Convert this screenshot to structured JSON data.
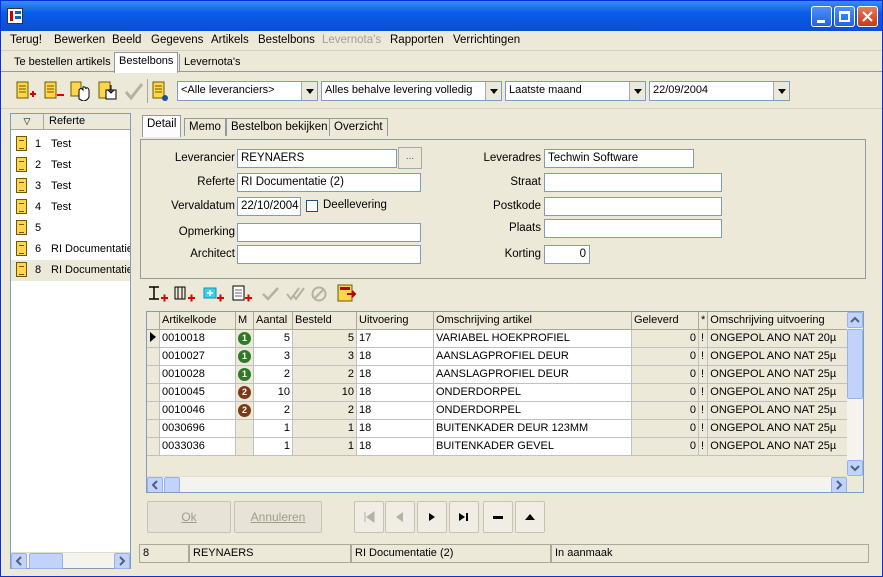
{
  "menu": {
    "items": [
      {
        "label": "Terug!",
        "disabled": false
      },
      {
        "label": "Bewerken",
        "disabled": false
      },
      {
        "label": "Beeld",
        "disabled": false
      },
      {
        "label": "Gegevens",
        "disabled": false
      },
      {
        "label": "Artikels",
        "disabled": false
      },
      {
        "label": "Bestelbons",
        "disabled": false
      },
      {
        "label": "Levernota's",
        "disabled": true
      },
      {
        "label": "Rapporten",
        "disabled": false
      },
      {
        "label": "Verrichtingen",
        "disabled": false
      }
    ]
  },
  "subtabs": [
    "Te bestellen artikels",
    "Bestelbons",
    "Levernota's"
  ],
  "filters": {
    "supplier": "<Alle leveranciers>",
    "status": "Alles behalve levering volledig",
    "period": "Laatste maand",
    "date": "22/09/2004"
  },
  "list": {
    "header_sort": "▽",
    "header_ref": "Referte",
    "rows": [
      {
        "num": "1",
        "ref": "Test"
      },
      {
        "num": "2",
        "ref": "Test"
      },
      {
        "num": "3",
        "ref": "Test"
      },
      {
        "num": "4",
        "ref": "Test"
      },
      {
        "num": "5",
        "ref": ""
      },
      {
        "num": "6",
        "ref": "RI Documentatie"
      },
      {
        "num": "8",
        "ref": "RI Documentatie"
      }
    ]
  },
  "tabs": [
    "Detail",
    "Memo",
    "Bestelbon bekijken",
    "Overzicht"
  ],
  "detail": {
    "leverancier_label": "Leverancier",
    "leverancier": "REYNAERS",
    "dots": "...",
    "referte_label": "Referte",
    "referte": "RI Documentatie (2)",
    "vervaldatum_label": "Vervaldatum",
    "vervaldatum": "22/10/2004",
    "deellevering_label": "Deellevering",
    "opmerking_label": "Opmerking",
    "opmerking": "",
    "architect_label": "Architect",
    "architect": "",
    "leveradres_label": "Leveradres",
    "leveradres": "Techwin Software",
    "straat_label": "Straat",
    "straat": "",
    "postkode_label": "Postkode",
    "postkode": "",
    "plaats_label": "Plaats",
    "plaats": "",
    "korting_label": "Korting",
    "korting": "0"
  },
  "grid": {
    "columns": [
      "Artikelkode",
      "M",
      "Aantal",
      "Besteld",
      "Uitvoering",
      "Omschrijving artikel",
      "Geleverd",
      "*",
      "Omschrijving uitvoering"
    ],
    "rows": [
      {
        "code": "0010018",
        "m": "1",
        "aantal": "5",
        "besteld": "5",
        "uitv": "17",
        "omschr": "VARIABEL HOEKPROFIEL",
        "gelev": "0",
        "star": "!",
        "omschr_uitv": "ONGEPOL ANO NAT 20µ"
      },
      {
        "code": "0010027",
        "m": "1",
        "aantal": "3",
        "besteld": "3",
        "uitv": "18",
        "omschr": "AANSLAGPROFIEL DEUR",
        "gelev": "0",
        "star": "!",
        "omschr_uitv": "ONGEPOL ANO NAT 25µ"
      },
      {
        "code": "0010028",
        "m": "1",
        "aantal": "2",
        "besteld": "2",
        "uitv": "18",
        "omschr": "AANSLAGPROFIEL DEUR",
        "gelev": "0",
        "star": "!",
        "omschr_uitv": "ONGEPOL ANO NAT 25µ"
      },
      {
        "code": "0010045",
        "m": "2",
        "aantal": "10",
        "besteld": "10",
        "uitv": "18",
        "omschr": "ONDERDORPEL",
        "gelev": "0",
        "star": "!",
        "omschr_uitv": "ONGEPOL ANO NAT 25µ"
      },
      {
        "code": "0010046",
        "m": "2",
        "aantal": "2",
        "besteld": "2",
        "uitv": "18",
        "omschr": "ONDERDORPEL",
        "gelev": "0",
        "star": "!",
        "omschr_uitv": "ONGEPOL ANO NAT 25µ"
      },
      {
        "code": "0030696",
        "m": "",
        "aantal": "1",
        "besteld": "1",
        "uitv": "18",
        "omschr": "BUITENKADER DEUR 123MM",
        "gelev": "0",
        "star": "!",
        "omschr_uitv": "ONGEPOL ANO NAT 25µ"
      },
      {
        "code": "0033036",
        "m": "",
        "aantal": "1",
        "besteld": "1",
        "uitv": "18",
        "omschr": "BUITENKADER GEVEL",
        "gelev": "0",
        "star": "!",
        "omschr_uitv": "ONGEPOL ANO NAT 25µ"
      }
    ]
  },
  "buttons": {
    "ok": "Ok",
    "annuleren": "Annuleren"
  },
  "status": {
    "num": "8",
    "supplier": "REYNAERS",
    "referte": "RI Documentatie (2)",
    "state": "In aanmaak"
  },
  "colors": {
    "titlebar": "#0a5ce8",
    "badge_green": "#2f7a2a",
    "badge_brown": "#7a3a1a"
  }
}
